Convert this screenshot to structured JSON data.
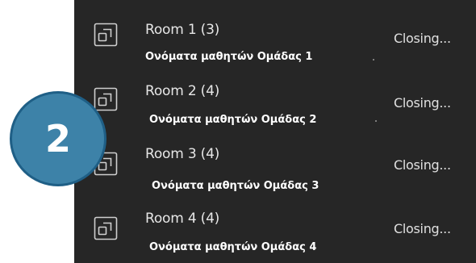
{
  "breakout_rooms": [
    {
      "name": "Room 1 (3)",
      "members": "Ονόματα μαθητών Ομάδας 1",
      "status": "Closing..."
    },
    {
      "name": "Room 2 (4)",
      "members": "Ονόματα μαθητών Ομάδας 2",
      "status": "Closing..."
    },
    {
      "name": "Room 3 (4)",
      "members": "Ονόματα μαθητών Ομάδας  3",
      "status": "Closing..."
    },
    {
      "name": "Room 4 (4)",
      "members": "Ονόματα μαθητών Ομάδας  4",
      "status": "Closing..."
    }
  ],
  "step_badge": {
    "number": "2",
    "color": "#3d82a8"
  },
  "icons": {
    "room": "room-icon"
  }
}
